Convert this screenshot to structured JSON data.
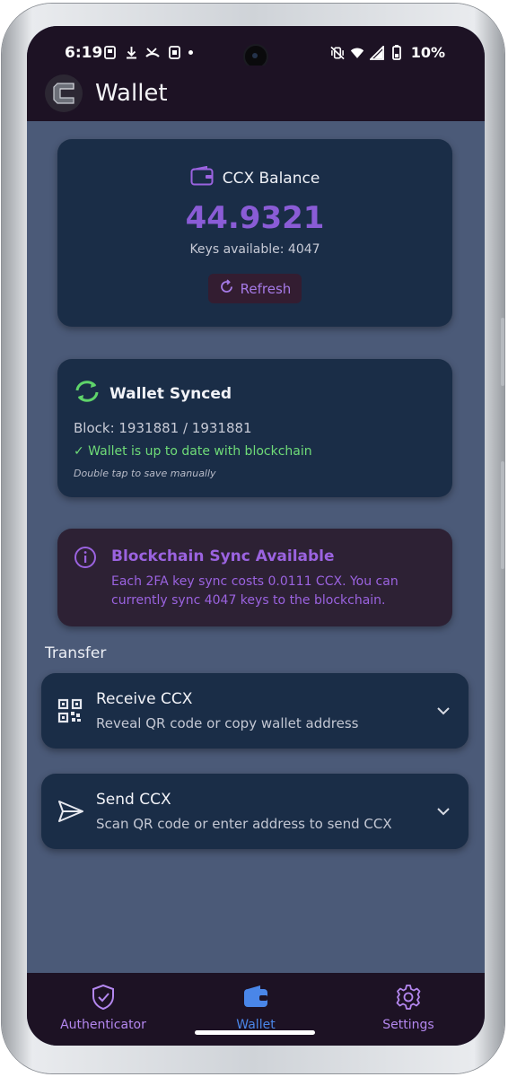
{
  "status_bar": {
    "time": "6:19",
    "left_icons": [
      "screenshot-icon",
      "download-icon",
      "missed-call-icon",
      "copy-icon"
    ],
    "right_icons": [
      "vibrate-off-icon",
      "wifi-icon",
      "signal-icon",
      "battery-icon"
    ],
    "battery": "10%"
  },
  "app_bar": {
    "title": "Wallet",
    "logo_icon": "ccx-logo-icon"
  },
  "balance": {
    "label": "CCX Balance",
    "amount": "44.9321",
    "keys_available": "Keys available: 4047",
    "refresh_label": "Refresh"
  },
  "sync": {
    "title": "Wallet Synced",
    "block": "Block: 1931881 / 1931881",
    "status": "✓ Wallet is up to date with blockchain",
    "hint": "Double tap to save manually"
  },
  "info": {
    "title": "Blockchain Sync Available",
    "body": "Each 2FA key sync costs 0.0111 CCX. You can currently sync 4047 keys to the blockchain."
  },
  "transfer": {
    "section_title": "Transfer",
    "items": [
      {
        "title": "Receive CCX",
        "subtitle": "Reveal QR code or copy wallet address",
        "icon": "qr-code-icon"
      },
      {
        "title": "Send CCX",
        "subtitle": "Scan QR code or enter address to send CCX",
        "icon": "send-icon"
      }
    ]
  },
  "bottom_nav": [
    {
      "label": "Authenticator",
      "icon": "shield-check-icon",
      "active": false
    },
    {
      "label": "Wallet",
      "icon": "wallet-icon",
      "active": true
    },
    {
      "label": "Settings",
      "icon": "gear-icon",
      "active": false
    }
  ],
  "colors": {
    "accent": "#8a5cd6",
    "success": "#6fdc78",
    "active_nav": "#4a86e8",
    "card": "#1a2d47",
    "background": "#4b5a78"
  }
}
